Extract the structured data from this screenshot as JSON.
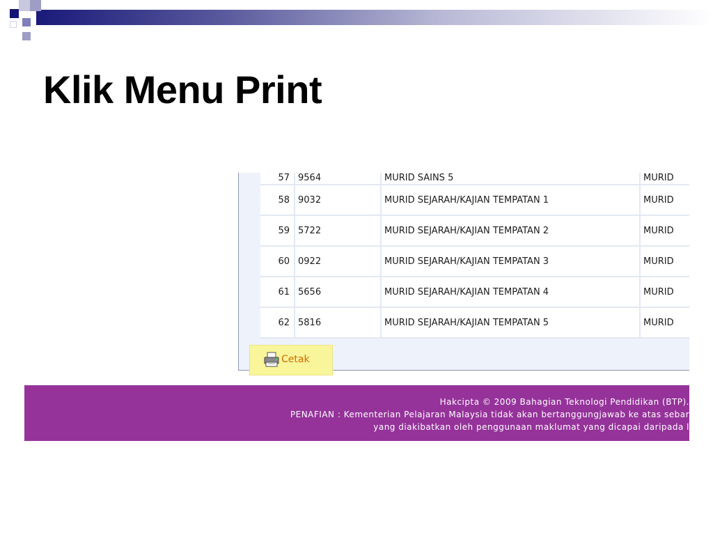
{
  "slide": {
    "title": "Klik Menu Print"
  },
  "table": {
    "rows": [
      {
        "no": "57",
        "code": "9564",
        "name": "MURID SAINS 5",
        "role": "MURID"
      },
      {
        "no": "58",
        "code": "9032",
        "name": "MURID SEJARAH/KAJIAN TEMPATAN 1",
        "role": "MURID"
      },
      {
        "no": "59",
        "code": "5722",
        "name": "MURID SEJARAH/KAJIAN TEMPATAN 2",
        "role": "MURID"
      },
      {
        "no": "60",
        "code": "0922",
        "name": "MURID SEJARAH/KAJIAN TEMPATAN 3",
        "role": "MURID"
      },
      {
        "no": "61",
        "code": "5656",
        "name": "MURID SEJARAH/KAJIAN TEMPATAN 4",
        "role": "MURID"
      },
      {
        "no": "62",
        "code": "5816",
        "name": "MURID SEJARAH/KAJIAN TEMPATAN 5",
        "role": "MURID"
      }
    ]
  },
  "print_button": {
    "label": "Cetak",
    "icon": "printer-icon"
  },
  "footer": {
    "line1": "Hakcipta © 2009 Bahagian Teknologi Pendidikan (BTP).",
    "line2": "PENAFIAN : Kementerian Pelajaran Malaysia tidak akan bertanggungjawab ke atas sebar",
    "line3": "yang diakibatkan oleh penggunaan maklumat yang dicapai daripada l"
  },
  "colors": {
    "footer_bg": "#95339a",
    "highlight": "#f9f59a",
    "print_label": "#d46b00",
    "panel_bg": "#eef2fb"
  }
}
